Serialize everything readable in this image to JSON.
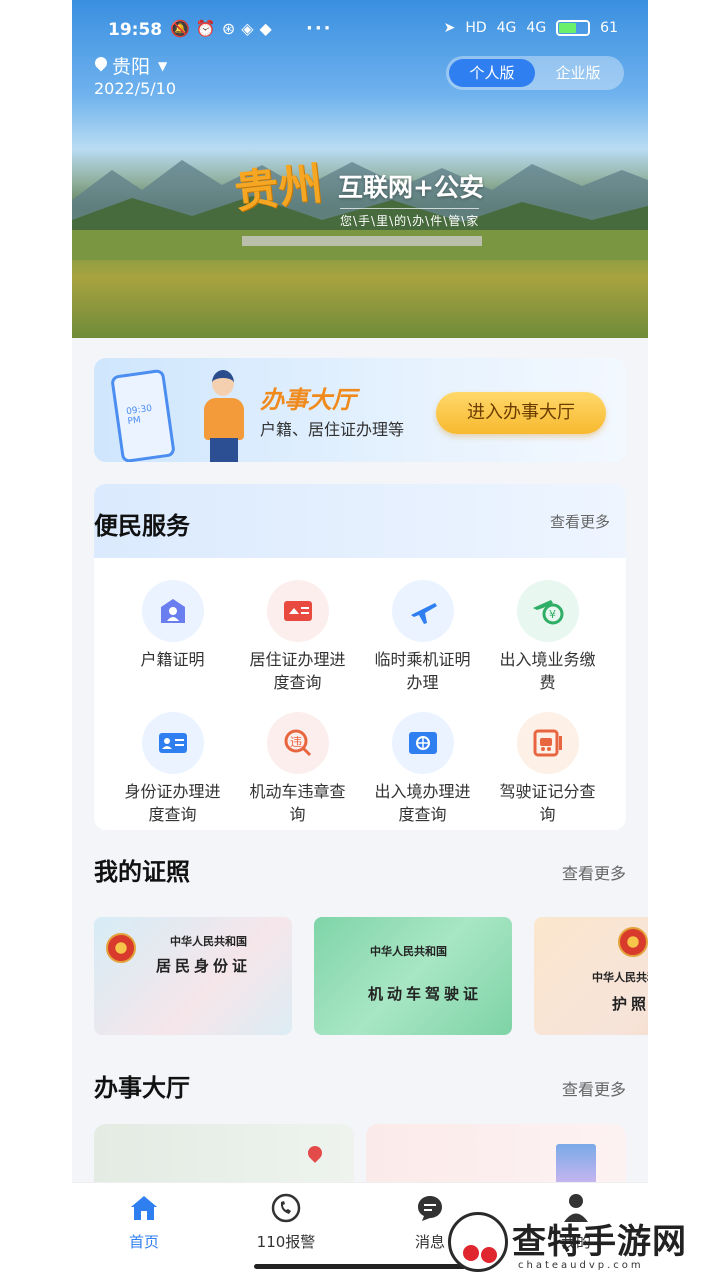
{
  "status_bar": {
    "time": "19:58",
    "more": "···",
    "network_labels": [
      "HD",
      "4G",
      "4G"
    ],
    "battery": "61"
  },
  "location": {
    "city": "贵阳",
    "date": "2022/5/10"
  },
  "mode_switch": {
    "options": [
      "个人版",
      "企业版"
    ],
    "selected": "个人版"
  },
  "banner": {
    "calligraphy": "贵州",
    "title": "互联网+公安",
    "subtitle": "您\\手\\里\\的\\办\\件\\管\\家"
  },
  "hall_card": {
    "illustration_time": "09:30 PM",
    "title": "办事大厅",
    "description": "户籍、居住证办理等",
    "button": "进入办事大厅"
  },
  "services": {
    "title": "便民服务",
    "more": "查看更多",
    "items": [
      {
        "label": "户籍证明",
        "icon": "household-icon",
        "tone": "blue"
      },
      {
        "label": "居住证办理进度查询",
        "icon": "residence-card-icon",
        "tone": "red"
      },
      {
        "label": "临时乘机证明办理",
        "icon": "airplane-icon",
        "tone": "blue"
      },
      {
        "label": "出入境业务缴费",
        "icon": "payment-plane-icon",
        "tone": "green"
      },
      {
        "label": "身份证办理进度查询",
        "icon": "id-card-icon",
        "tone": "blue"
      },
      {
        "label": "机动车违章查询",
        "icon": "traffic-violation-icon",
        "tone": "red"
      },
      {
        "label": "出入境办理进度查询",
        "icon": "passport-icon",
        "tone": "blue"
      },
      {
        "label": "驾驶证记分查询",
        "icon": "driver-license-icon",
        "tone": "orange"
      }
    ]
  },
  "my_licenses": {
    "title": "我的证照",
    "more": "查看更多",
    "cards": [
      {
        "issuer": "中华人民共和国",
        "name": "居民身份证"
      },
      {
        "issuer": "中华人民共和国",
        "name": "机动车驾驶证"
      },
      {
        "issuer": "中华人民共和国",
        "name": "护照"
      }
    ]
  },
  "hall_section": {
    "title": "办事大厅",
    "more": "查看更多"
  },
  "tabbar": {
    "items": [
      "首页",
      "110报警",
      "消息",
      "我的"
    ],
    "active": "首页"
  },
  "watermark": {
    "text": "查特手游网",
    "url": "chateaudvp.com"
  },
  "colors": {
    "accent": "#2f7ff0",
    "hall_title": "#f08a1c",
    "button_gold": "#f7b92f"
  }
}
